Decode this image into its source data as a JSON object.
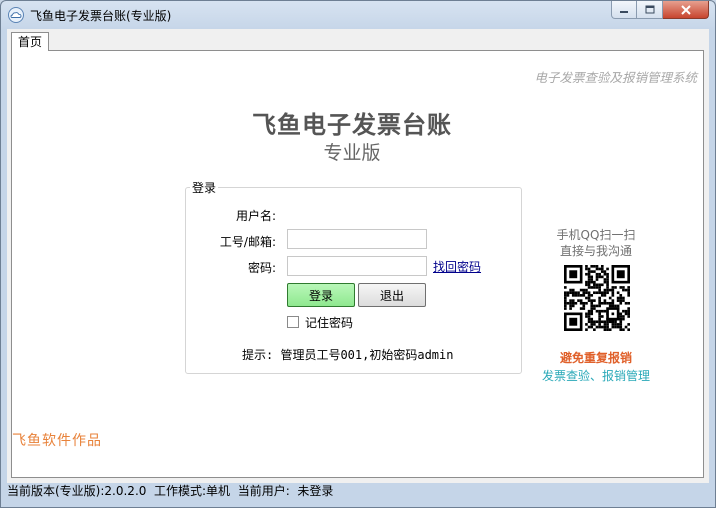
{
  "window": {
    "title": "飞鱼电子发票台账(专业版)"
  },
  "tabs": [
    {
      "label": "首页"
    }
  ],
  "header": {
    "tagline": "电子发票查验及报销管理系统",
    "app_name": "飞鱼电子发票台账",
    "edition": "专业版"
  },
  "login": {
    "group_title": "登录",
    "username_label": "用户名:",
    "username_value": "",
    "account_label": "工号/邮箱:",
    "account_value": "",
    "password_label": "密码:",
    "password_value": "",
    "recover_link": "找回密码",
    "login_button": "登录",
    "exit_button": "退出",
    "remember_label": "记住密码",
    "remember_checked": false,
    "hint": "提示: 管理员工号001,初始密码admin"
  },
  "side": {
    "qq_line1": "手机QQ扫一扫",
    "qq_line2": "直接与我沟通",
    "promo_line1": "避免重复报销",
    "promo_line2": "发票查验、报销管理"
  },
  "footer": {
    "author": "飞鱼软件作品"
  },
  "status": {
    "text": "当前版本(专业版):2.0.2.0  工作模式:单机  当前用户:  未登录"
  },
  "icons": {
    "app": "cloud-app-icon",
    "minimize": "minimize-icon",
    "maximize": "maximize-icon",
    "close": "close-icon",
    "qr": "qr-code"
  }
}
